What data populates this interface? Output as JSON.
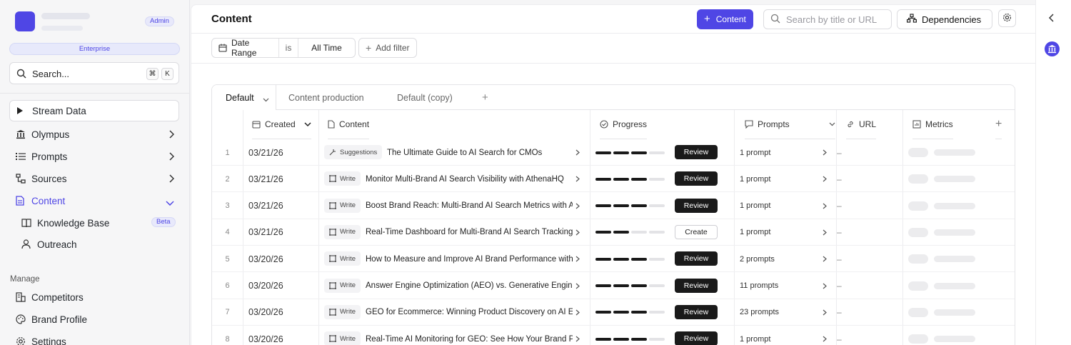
{
  "sidebar": {
    "admin_badge": "Admin",
    "plan": "Enterprise",
    "search": {
      "label": "Search...",
      "kbd": [
        "⌘",
        "K"
      ]
    },
    "nav": [
      {
        "label": "Stream Data",
        "icon": "play-icon"
      },
      {
        "label": "Olympus",
        "icon": "temple-icon"
      },
      {
        "label": "Prompts",
        "icon": "list-icon"
      },
      {
        "label": "Sources",
        "icon": "sources-icon"
      },
      {
        "label": "Content",
        "icon": "document-icon"
      }
    ],
    "sub": [
      {
        "label": "Knowledge Base",
        "badge": "Beta",
        "icon": "book-icon"
      },
      {
        "label": "Outreach",
        "icon": "user-icon"
      }
    ],
    "manage_label": "Manage",
    "manage": [
      {
        "label": "Competitors",
        "icon": "building-icon"
      },
      {
        "label": "Brand Profile",
        "icon": "palette-icon"
      },
      {
        "label": "Settings",
        "icon": "gear-icon"
      }
    ]
  },
  "header": {
    "title": "Content",
    "new_button": "Content",
    "search_placeholder": "Search by title or URL",
    "dependencies": "Dependencies"
  },
  "filter": {
    "field": "Date Range",
    "operator": "is",
    "value": "All Time",
    "add": "Add filter"
  },
  "tabs": [
    "Default",
    "Content production",
    "Default (copy)"
  ],
  "columns": {
    "created": "Created",
    "content": "Content",
    "progress": "Progress",
    "prompts": "Prompts",
    "url": "URL",
    "metrics": "Metrics"
  },
  "rows": [
    {
      "num": "1",
      "date": "03/21/26",
      "tag": "Suggestions",
      "title": "The Ultimate Guide to AI Search for CMOs",
      "progress": 3,
      "status": "Review",
      "prompts": "1 prompt",
      "url": "–"
    },
    {
      "num": "2",
      "date": "03/21/26",
      "tag": "Write",
      "title": "Monitor Multi-Brand AI Search Visibility with AthenaHQ",
      "progress": 3,
      "status": "Review",
      "prompts": "1 prompt",
      "url": "–"
    },
    {
      "num": "3",
      "date": "03/21/26",
      "tag": "Write",
      "title": "Boost Brand Reach: Multi-Brand AI Search Metrics with Athena",
      "progress": 3,
      "status": "Review",
      "prompts": "1 prompt",
      "url": "–"
    },
    {
      "num": "4",
      "date": "03/21/26",
      "tag": "Write",
      "title": "Real-Time Dashboard for Multi-Brand AI Search Tracking",
      "progress": 2,
      "status": "Create",
      "prompts": "1 prompt",
      "url": "–"
    },
    {
      "num": "5",
      "date": "03/20/26",
      "tag": "Write",
      "title": "How to Measure and Improve AI Brand Performance with GEO",
      "progress": 3,
      "status": "Review",
      "prompts": "2 prompts",
      "url": "–"
    },
    {
      "num": "6",
      "date": "03/20/26",
      "tag": "Write",
      "title": "Answer Engine Optimization (AEO) vs. Generative Engine Optimization",
      "progress": 3,
      "status": "Review",
      "prompts": "11 prompts",
      "url": "–"
    },
    {
      "num": "7",
      "date": "03/20/26",
      "tag": "Write",
      "title": "GEO for Ecommerce: Winning Product Discovery on AI Engines",
      "progress": 3,
      "status": "Review",
      "prompts": "23 prompts",
      "url": "–"
    },
    {
      "num": "8",
      "date": "03/20/26",
      "tag": "Write",
      "title": "Real-Time AI Monitoring for GEO: See How Your Brand Performs",
      "progress": 3,
      "status": "Review",
      "prompts": "1 prompt",
      "url": "–"
    }
  ]
}
